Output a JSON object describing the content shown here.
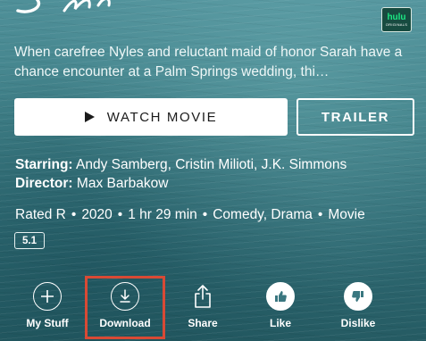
{
  "network_badge": {
    "line1": "hulu",
    "line2": "ORIGINALS"
  },
  "description": "When carefree Nyles and reluctant maid of honor Sarah have a chance encounter at a Palm Springs wedding, thi…",
  "buttons": {
    "watch": "WATCH MOVIE",
    "trailer": "TRAILER"
  },
  "credits": {
    "starring_label": "Starring:",
    "starring": "Andy Samberg, Cristin Milioti, J.K. Simmons",
    "director_label": "Director:",
    "director": "Max Barbakow"
  },
  "meta": {
    "rating": "Rated R",
    "year": "2020",
    "duration": "1 hr 29 min",
    "genres": "Comedy, Drama",
    "type": "Movie",
    "separator": "•"
  },
  "audio_badge": "5.1",
  "actions": [
    {
      "label": "My Stuff",
      "icon": "plus-icon"
    },
    {
      "label": "Download",
      "icon": "download-icon"
    },
    {
      "label": "Share",
      "icon": "share-icon"
    },
    {
      "label": "Like",
      "icon": "thumbs-up-icon"
    },
    {
      "label": "Dislike",
      "icon": "thumbs-down-icon"
    }
  ],
  "colors": {
    "brand_green": "#1ce783",
    "highlight": "#d84a35",
    "background": "#3f7f87"
  }
}
